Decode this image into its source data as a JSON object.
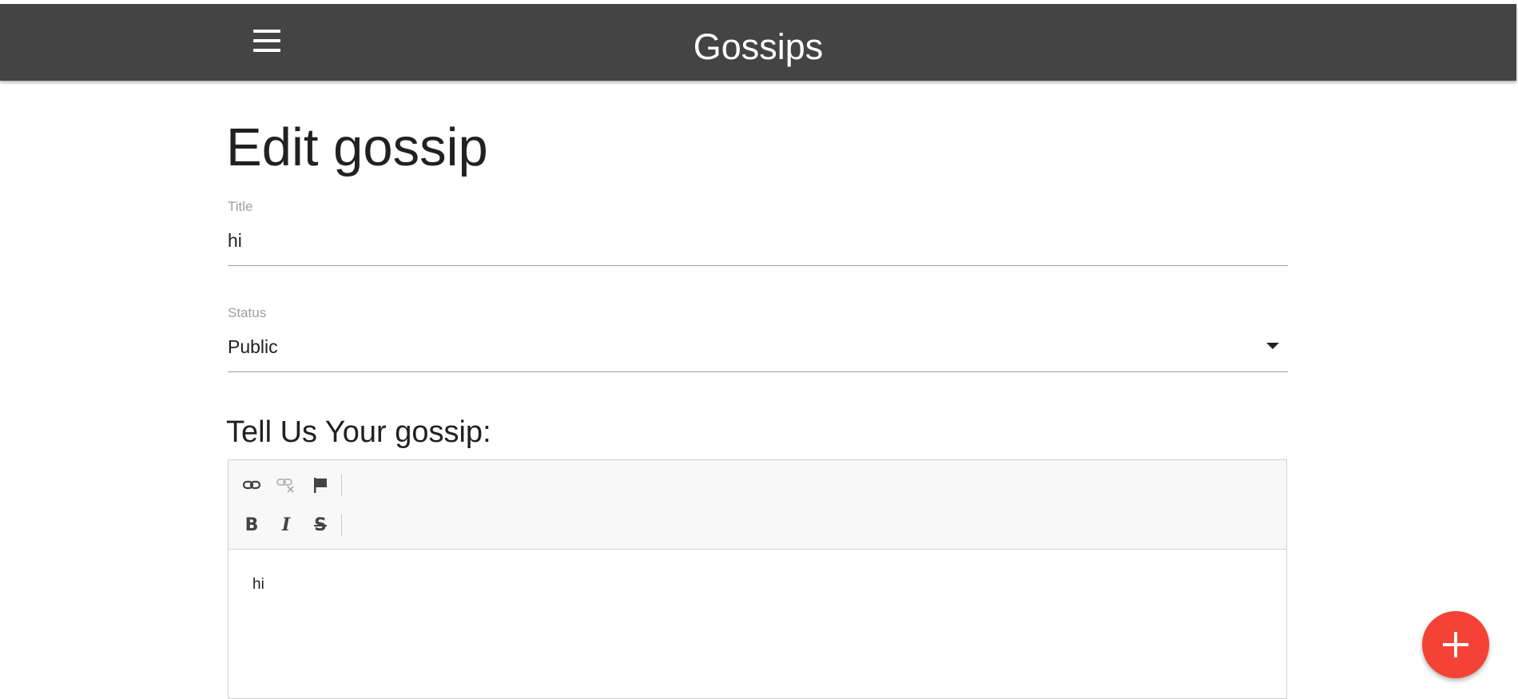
{
  "header": {
    "app_title": "Gossips",
    "menu_icon": "hamburger-menu-icon",
    "background": "#444444"
  },
  "page": {
    "title": "Edit gossip"
  },
  "form": {
    "title_field": {
      "label": "Title",
      "value": "hi"
    },
    "status_field": {
      "label": "Status",
      "value": "Public"
    },
    "content_heading": "Tell Us Your gossip:"
  },
  "editor": {
    "toolbar_row1": [
      "link-icon",
      "unlink-icon",
      "anchor-flag-icon"
    ],
    "toolbar_row2": [
      "bold-icon",
      "italic-icon",
      "strikethrough-icon"
    ],
    "bold_label": "B",
    "italic_label": "I",
    "strike_label": "S",
    "content": "hi"
  },
  "fab": {
    "icon": "plus-icon",
    "color": "#f44336"
  }
}
